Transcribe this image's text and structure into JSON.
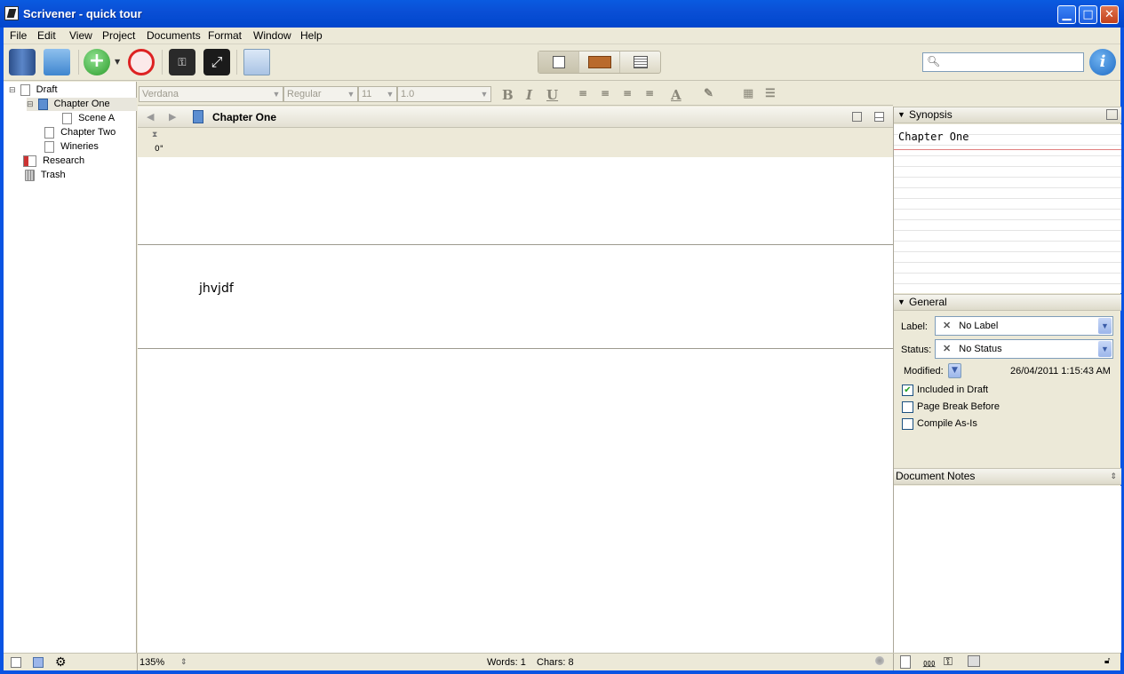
{
  "window": {
    "title": "Scrivener - quick tour"
  },
  "menu": [
    "File",
    "Edit",
    "View",
    "Project",
    "Documents",
    "Format",
    "Window",
    "Help"
  ],
  "binder": {
    "items": [
      {
        "label": "Draft"
      },
      {
        "label": "Chapter One"
      },
      {
        "label": "Scene A"
      },
      {
        "label": "Chapter Two"
      },
      {
        "label": "Wineries"
      },
      {
        "label": "Research"
      },
      {
        "label": "Trash"
      }
    ]
  },
  "format_bar": {
    "font": "Verdana",
    "style": "Regular",
    "size": "11",
    "spacing": "1.0"
  },
  "editor": {
    "header_title": "Chapter One",
    "ruler_marker": "0\"",
    "body_text": "jhvjdf"
  },
  "inspector": {
    "synopsis_header": "Synopsis",
    "synopsis_text": "Chapter One",
    "general_header": "General",
    "label_caption": "Label:",
    "label_value": "No Label",
    "status_caption": "Status:",
    "status_value": "No Status",
    "modified_caption": "Modified:",
    "modified_value": "26/04/2011 1:15:43 AM",
    "included_in_draft": "Included in Draft",
    "page_break_before": "Page Break Before",
    "compile_as_is": "Compile As-Is",
    "notes_header": "Document Notes"
  },
  "statusbar": {
    "zoom": "135%",
    "words": "Words: 1",
    "chars": "Chars: 8"
  },
  "colors": {
    "titlebar": "#0a54e3",
    "chrome": "#ece9d8",
    "accent": "#1f6cc5"
  }
}
